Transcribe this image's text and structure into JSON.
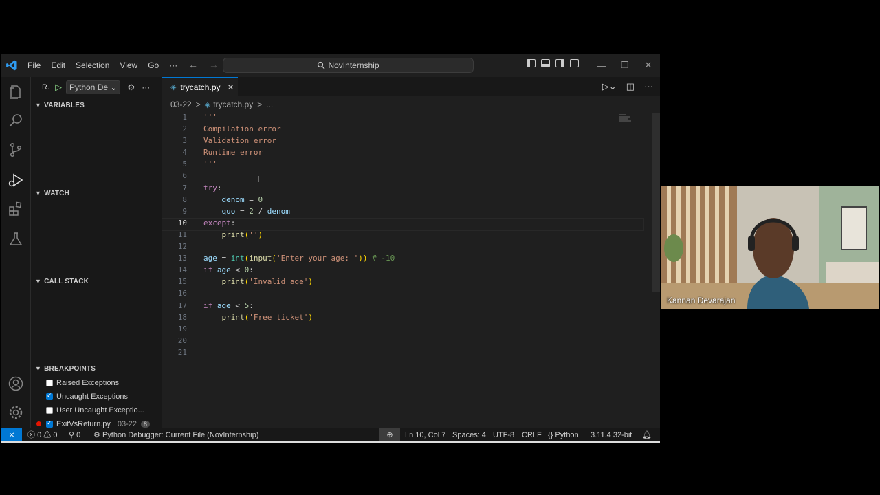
{
  "window": {
    "command_center": "NovInternship",
    "menu": [
      "File",
      "Edit",
      "Selection",
      "View",
      "Go",
      "···"
    ]
  },
  "debug": {
    "run_label": "R.",
    "config": "Python De"
  },
  "sidebar": {
    "variables": "VARIABLES",
    "watch": "WATCH",
    "call_stack": "CALL STACK",
    "breakpoints": "BREAKPOINTS",
    "bp_items": [
      {
        "label": "Raised Exceptions",
        "checked": false
      },
      {
        "label": "Uncaught Exceptions",
        "checked": true
      },
      {
        "label": "User Uncaught Exceptio...",
        "checked": false
      },
      {
        "label": "ExitVsReturn.py",
        "checked": true,
        "path": "03-22",
        "count": "8"
      }
    ]
  },
  "editor": {
    "tab": "trycatch.py",
    "breadcrumb": [
      "03-22",
      ">",
      "trycatch.py",
      ">",
      "..."
    ],
    "current_line": "10",
    "lines": [
      "'''",
      "Compilation error",
      "Validation error",
      "Runtime error",
      "'''",
      "",
      "try:",
      "    denom = 0",
      "    quo = 2 / denom",
      "except:",
      "    print('')",
      "",
      "age = int(input('Enter your age: ')) # -10",
      "if age < 0:",
      "    print('Invalid age')",
      "",
      "if age < 5:",
      "    print('Free ticket')",
      "",
      "",
      ""
    ]
  },
  "status": {
    "errors": "0",
    "warnings": "0",
    "ports": "0",
    "debug": "Python Debugger: Current File (NovInternship)",
    "position": "Ln 10, Col 7",
    "spaces": "Spaces: 4",
    "encoding": "UTF-8",
    "eol": "CRLF",
    "language": "Python",
    "interpreter": "3.11.4 32-bit"
  },
  "webcam": {
    "name": "Kannan Devarajan"
  }
}
